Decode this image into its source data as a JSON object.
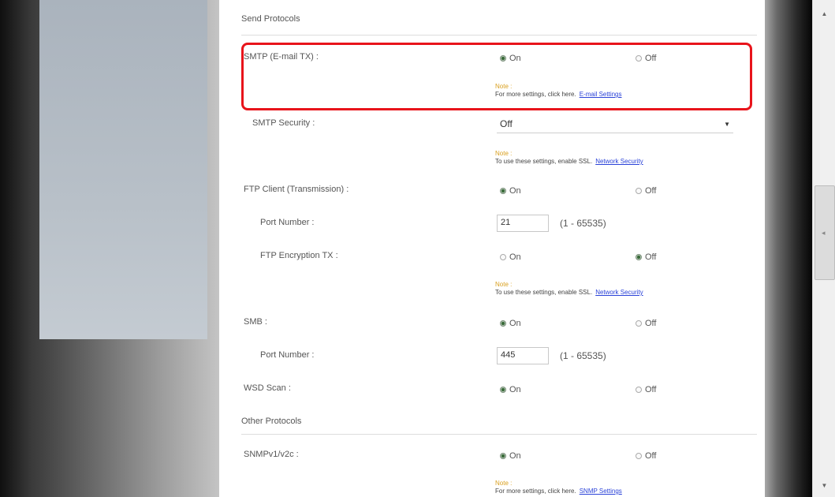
{
  "send_protocols": {
    "title": "Send Protocols",
    "smtp": {
      "label": "SMTP (E-mail TX) :",
      "on": "On",
      "off": "Off",
      "note_label": "Note :",
      "note_text": "For more settings, click here.",
      "note_link": "E-mail Settings"
    },
    "smtp_security": {
      "label": "SMTP Security :",
      "value": "Off",
      "note_label": "Note :",
      "note_text": "To use these settings, enable SSL.",
      "note_link": "Network Security"
    },
    "ftp_client": {
      "label": "FTP Client (Transmission) :",
      "on": "On",
      "off": "Off"
    },
    "ftp_port": {
      "label": "Port Number :",
      "value": "21",
      "range": "(1 - 65535)"
    },
    "ftp_encryption": {
      "label": "FTP Encryption TX :",
      "on": "On",
      "off": "Off",
      "note_label": "Note :",
      "note_text": "To use these settings, enable SSL.",
      "note_link": "Network Security"
    },
    "smb": {
      "label": "SMB :",
      "on": "On",
      "off": "Off"
    },
    "smb_port": {
      "label": "Port Number :",
      "value": "445",
      "range": "(1 - 65535)"
    },
    "wsd_scan": {
      "label": "WSD Scan :",
      "on": "On",
      "off": "Off"
    }
  },
  "other_protocols": {
    "title": "Other Protocols",
    "snmp": {
      "label": "SNMPv1/v2c :",
      "on": "On",
      "off": "Off",
      "note_label": "Note :",
      "note_text": "For more settings, click here.",
      "note_link": "SNMP Settings"
    }
  },
  "colors": {
    "highlight": "#e8141b",
    "link": "#2a42d8",
    "note_label": "#d9a020"
  },
  "icons": {
    "radio_selected": "radio-selected-icon",
    "radio_unselected": "radio-unselected-icon",
    "dropdown": "chevron-down-icon"
  }
}
